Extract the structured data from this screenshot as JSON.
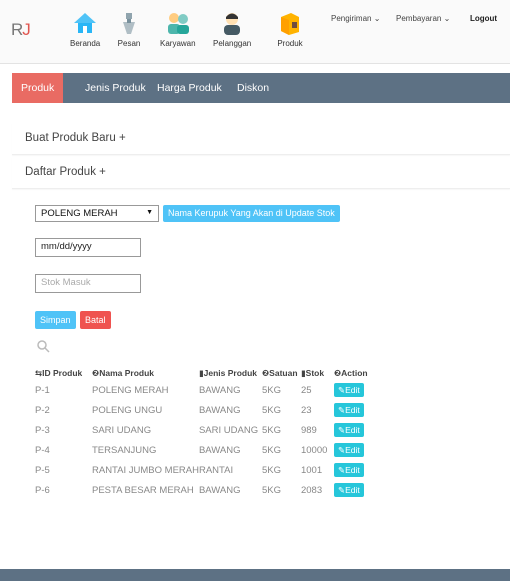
{
  "brand": {
    "text_r": "R",
    "text_j": "J"
  },
  "nav": {
    "items": [
      {
        "label": "Beranda",
        "icon": "home-icon"
      },
      {
        "label": "Pesan",
        "icon": "message-icon"
      },
      {
        "label": "Karyawan",
        "icon": "people-icon"
      },
      {
        "label": "Pelanggan",
        "icon": "user-icon"
      },
      {
        "label": "Produk",
        "icon": "box-icon"
      }
    ],
    "pengiriman": "Pengiriman ⌄",
    "pembayaran": "Pembayaran ⌄",
    "logout": "Logout"
  },
  "tabs": [
    "Produk",
    "Jenis Produk",
    "Harga Produk",
    "Diskon"
  ],
  "sections": {
    "create": "Buat Produk Baru +",
    "list": "Daftar Produk +"
  },
  "form": {
    "select_value": "POLENG MERAH",
    "select_hint": "Nama Kerupuk Yang Akan di Update Stok",
    "date_value": "mm/dd/yyyy",
    "stock_placeholder": "Stok Masuk",
    "save_label": "Simpan",
    "cancel_label": "Batal"
  },
  "table": {
    "headers": [
      "ID Produk",
      "Nama Produk",
      "Jenis Produk",
      "Satuan",
      "Stok",
      "Action"
    ],
    "rows": [
      [
        "P-1",
        "POLENG MERAH",
        "BAWANG",
        "5KG",
        "25",
        "Edit"
      ],
      [
        "P-2",
        "POLENG UNGU",
        "BAWANG",
        "5KG",
        "23",
        "Edit"
      ],
      [
        "P-3",
        "SARI UDANG",
        "SARI UDANG",
        "5KG",
        "989",
        "Edit"
      ],
      [
        "P-4",
        "TERSANJUNG",
        "BAWANG",
        "5KG",
        "10000",
        "Edit"
      ],
      [
        "P-5",
        "RANTAI JUMBO MERAH",
        "RANTAI",
        "5KG",
        "1001",
        "Edit"
      ],
      [
        "P-6",
        "PESTA BESAR MERAH",
        "BAWANG",
        "5KG",
        "2083",
        "Edit"
      ]
    ]
  },
  "colors": {
    "tabbar": "#5d7184",
    "active_tab": "#e96b63",
    "info": "#4fc3f7",
    "danger": "#ef5350",
    "edit": "#26c6da"
  }
}
